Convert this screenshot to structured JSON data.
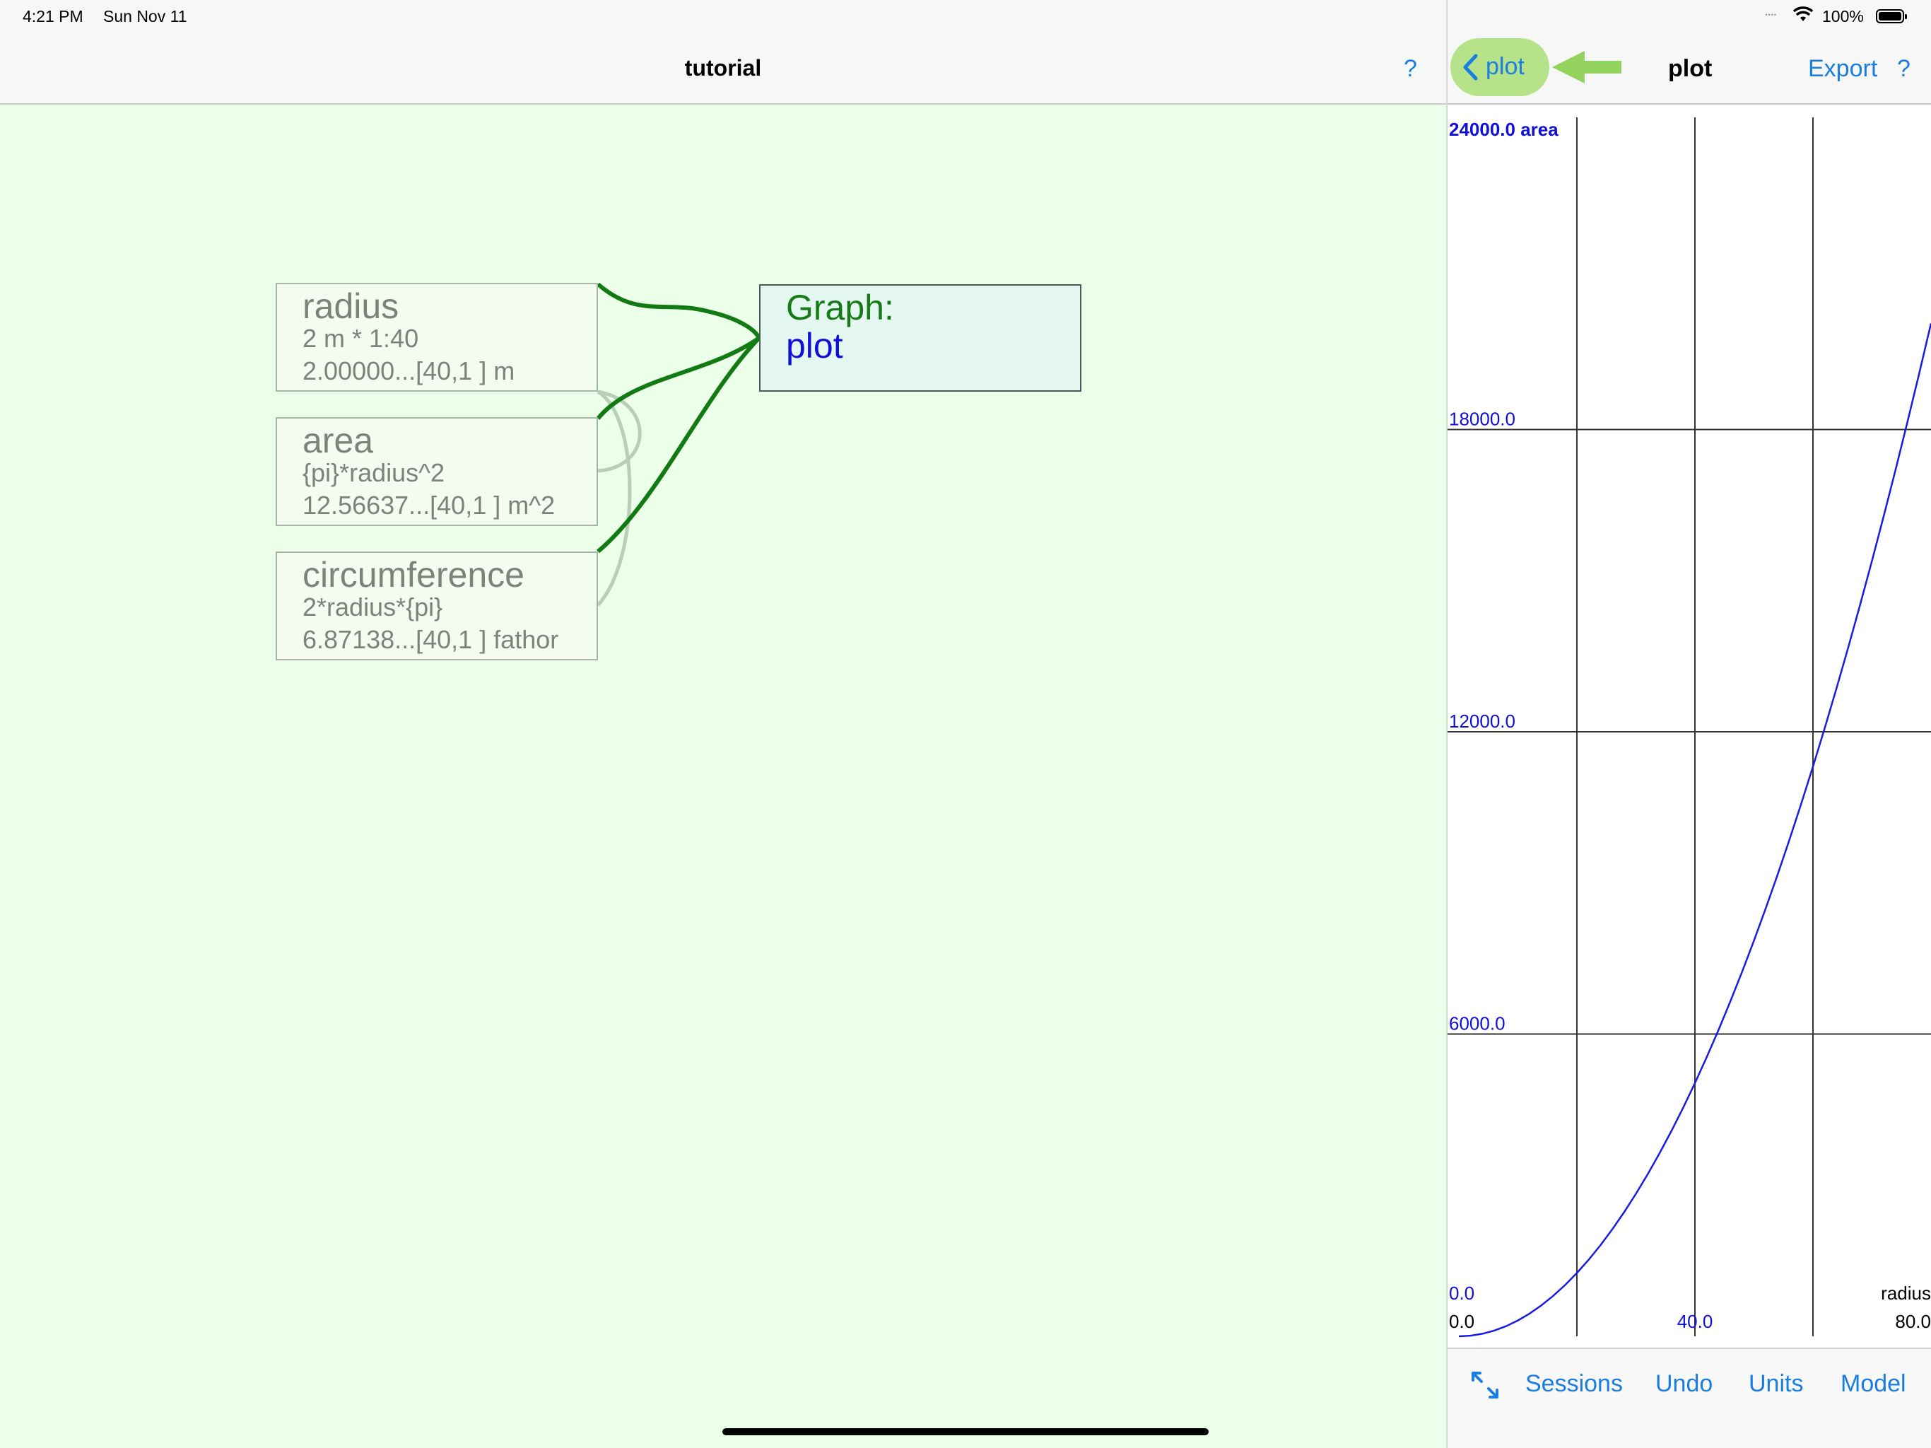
{
  "status_bar": {
    "time": "4:21 PM",
    "date": "Sun Nov 11",
    "dots": "....",
    "battery": "100%"
  },
  "left": {
    "title": "tutorial",
    "help": "?",
    "nodes": [
      {
        "name": "radius",
        "formula": "2 m * 1:40",
        "value": "2.00000...[40,1 ] m"
      },
      {
        "name": "area",
        "formula": "{pi}*radius^2",
        "value": "12.56637...[40,1 ] m^2"
      },
      {
        "name": "circumference",
        "formula": "2*radius*{pi}",
        "value": "6.87138...[40,1 ] fathor"
      }
    ],
    "graph_node": {
      "label": "Graph:",
      "name": "plot"
    }
  },
  "right": {
    "back_label": "plot",
    "title": "plot",
    "export": "Export",
    "help": "?",
    "toolbar": {
      "sessions": "Sessions",
      "undo": "Undo",
      "units": "Units",
      "model": "Model"
    }
  },
  "colors": {
    "accent": "#1a7ee0",
    "axis_label": "#1010d8",
    "wire": "#127a12",
    "wire_faint": "#b9cdb7",
    "back_highlight": "#b6e38a"
  },
  "icons": {
    "back": "chevron-left-icon",
    "annotation": "green-arrow-left-icon",
    "expand": "expand-arrows-icon",
    "wifi": "wifi-icon",
    "battery": "battery-icon"
  },
  "chart_data": {
    "type": "line",
    "x_label": "radius",
    "y_label": "area",
    "xlim": [
      0,
      80
    ],
    "ylim": [
      0,
      24000
    ],
    "x_tick_labels": [
      "0.0",
      "40.0",
      "80.0"
    ],
    "y_tick_labels": [
      "0.0",
      "6000.0",
      "12000.0",
      "18000.0",
      "24000.0"
    ],
    "top_label": "24000.0 area",
    "grid": true,
    "series": [
      {
        "x": [
          2,
          4,
          6,
          8,
          10,
          12,
          14,
          16,
          18,
          20,
          22,
          24,
          26,
          28,
          30,
          32,
          34,
          36,
          38,
          40,
          42,
          44,
          46,
          48,
          50,
          52,
          54,
          56,
          58,
          60,
          62,
          64,
          66,
          68,
          70,
          72,
          74,
          76,
          78,
          80
        ],
        "y": [
          12.57,
          50.27,
          113.1,
          201.1,
          314.2,
          452.4,
          615.8,
          804.2,
          1017.9,
          1256.6,
          1520.5,
          1809.6,
          2123.7,
          2463.0,
          2827.4,
          3217.0,
          3631.7,
          4071.5,
          4536.5,
          5026.5,
          5541.8,
          6082.1,
          6647.6,
          7238.2,
          7854.0,
          8494.9,
          9160.9,
          9852.0,
          10568.3,
          11309.7,
          12076.3,
          12868.0,
          13684.8,
          14526.7,
          15393.8,
          16286.0,
          17203.4,
          18145.8,
          19113.4,
          20106.2
        ],
        "color": "#1a1ae6"
      }
    ]
  }
}
